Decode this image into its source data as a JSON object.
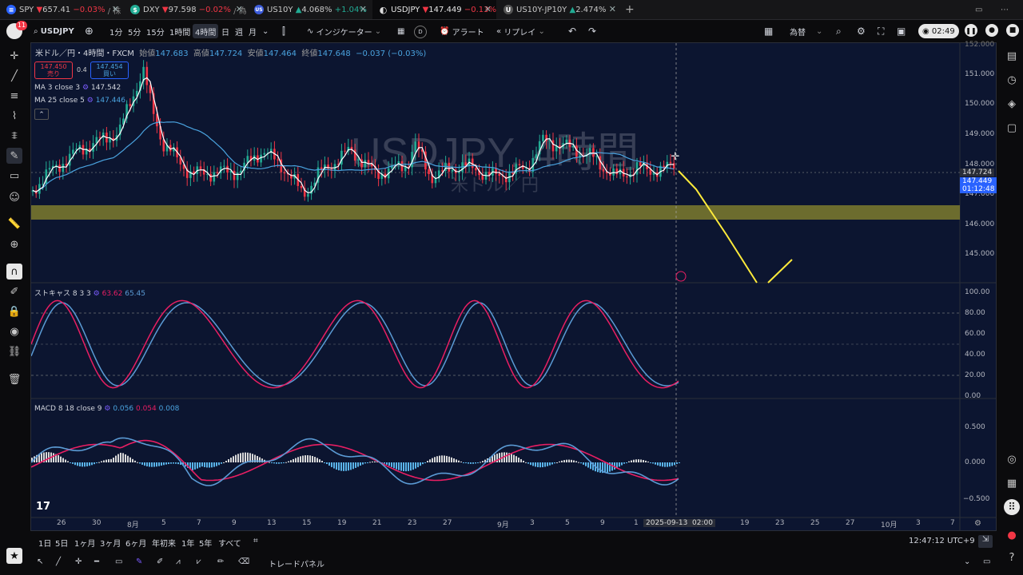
{
  "tabs": [
    {
      "icon_text": "≡",
      "icon_color": "#2962ff",
      "symbol": "SPY",
      "arrow": "▼",
      "price": "657.41",
      "change": "−0.03%",
      "desc": "/ 株",
      "dir": "dn"
    },
    {
      "icon_text": "$",
      "icon_color": "#22ab94",
      "symbol": "DXY",
      "arrow": "▼",
      "price": "97.598",
      "change": "−0.02%",
      "desc": "/ 為",
      "dir": "dn"
    },
    {
      "icon_text": "US",
      "icon_color": "#3b5bdb",
      "symbol": "US10Y",
      "arrow": "▲",
      "price": "4.068%",
      "change": "+1.04%",
      "desc": "",
      "dir": "up"
    },
    {
      "icon_text": "◐",
      "icon_color": "#0b0b0d",
      "symbol": "USDJPY",
      "arrow": "▼",
      "price": "147.449",
      "change": "−0.13%",
      "desc": "",
      "dir": "dn"
    },
    {
      "icon_text": "U",
      "icon_color": "#555",
      "symbol": "US10Y-JP10Y",
      "arrow": "▲",
      "price": "2.474%",
      "change": "",
      "desc": "",
      "dir": "up"
    }
  ],
  "new_tab": "+",
  "toolbar": {
    "avatar_badge": "11",
    "symbol": "USDJPY",
    "intervals": [
      "1分",
      "5分",
      "15分",
      "1時間",
      "4時間",
      "日",
      "週",
      "月"
    ],
    "selected_interval": "4時間",
    "indicators": "インジケーター",
    "alert": "アラート",
    "replay": "リプレイ",
    "layout_name": "為替",
    "timer": "02:49"
  },
  "legend": {
    "title": "米ドル／円・4時間・FXCM",
    "open_label": "始値",
    "open": "147.683",
    "high_label": "高値",
    "high": "147.724",
    "low_label": "安値",
    "low": "147.464",
    "close_label": "終値",
    "close": "147.648",
    "change": "−0.037 (−0.03%)",
    "sell_price": "147.450",
    "sell_label": "売り",
    "spread": "0.4",
    "buy_price": "147.454",
    "buy_label": "買い",
    "ma3": "MA 3 close 3",
    "ma3_value": "147.542",
    "ma25": "MA 25 close 5",
    "ma25_value": "147.446",
    "collapse": "⌃"
  },
  "watermark": {
    "symbol": "USDJPY, 4時間",
    "sub": "米ドル／円"
  },
  "price_axis": {
    "labels": [
      "151.000",
      "150.000",
      "149.000",
      "148.000",
      "147.000",
      "146.000",
      "145.000"
    ],
    "top_cut": "152.000",
    "high_tag": "147.724",
    "current_tag": "147.449",
    "countdown": "01:12:48"
  },
  "stoch": {
    "label": "ストキャス 8 3 3",
    "k": "63.62",
    "d": "65.45",
    "axis": [
      "100.00",
      "80.00",
      "60.00",
      "40.00",
      "20.00",
      "0.00"
    ]
  },
  "macd": {
    "label": "MACD 8 18 close 9",
    "v1": "0.056",
    "v2": "0.054",
    "v3": "0.008",
    "axis": [
      "0.500",
      "0.000",
      "−0.500"
    ]
  },
  "time_axis": [
    "26",
    "30",
    "8月",
    "5",
    "7",
    "9",
    "13",
    "15",
    "19",
    "21",
    "23",
    "27",
    "9月",
    "3",
    "5",
    "9",
    "1",
    "7",
    "19",
    "23",
    "25",
    "27",
    "10月",
    "3",
    "7"
  ],
  "crosshair_time": "2025-09-13",
  "crosshair_hour": "02:00",
  "bottom": {
    "ranges": [
      "1日",
      "5日",
      "1ヶ月",
      "3ヶ月",
      "6ヶ月",
      "年初来",
      "1年",
      "5年",
      "すべて"
    ],
    "clock": "12:47:12 UTC+9",
    "trade_panel": "トレードパネル"
  },
  "colors": {
    "ma3": "#ffffff",
    "ma25": "#4aa3df",
    "zone": "#8c8a2e",
    "projection": "#ffeb3b",
    "k": "#e91e63",
    "d": "#5b9bd5",
    "up": "#22ab94",
    "down": "#f23645"
  }
}
